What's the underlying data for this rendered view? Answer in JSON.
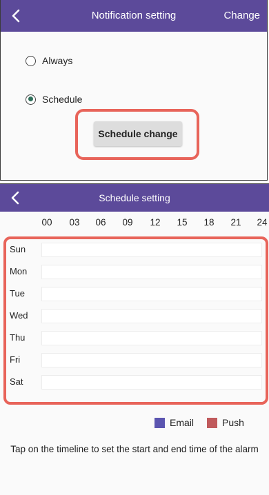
{
  "notification_screen": {
    "header": {
      "title": "Notification setting",
      "action_label": "Change"
    },
    "options": [
      {
        "label": "Always",
        "selected": false
      },
      {
        "label": "Schedule",
        "selected": true
      }
    ],
    "schedule_change_label": "Schedule change"
  },
  "schedule_screen": {
    "header": {
      "title": "Schedule setting"
    },
    "hours": [
      "00",
      "03",
      "06",
      "09",
      "12",
      "15",
      "18",
      "21",
      "24"
    ],
    "days": [
      "Sun",
      "Mon",
      "Tue",
      "Wed",
      "Thu",
      "Fri",
      "Sat"
    ],
    "legend": [
      {
        "label": "Email",
        "color": "#5b55b0"
      },
      {
        "label": "Push",
        "color": "#c05a5c"
      }
    ],
    "hint": "Tap on the timeline to set the start and end time of the alarm"
  },
  "colors": {
    "header": "#5c4a9a",
    "highlight": "#e8645a",
    "radio_selected": "#2f6f5a"
  }
}
